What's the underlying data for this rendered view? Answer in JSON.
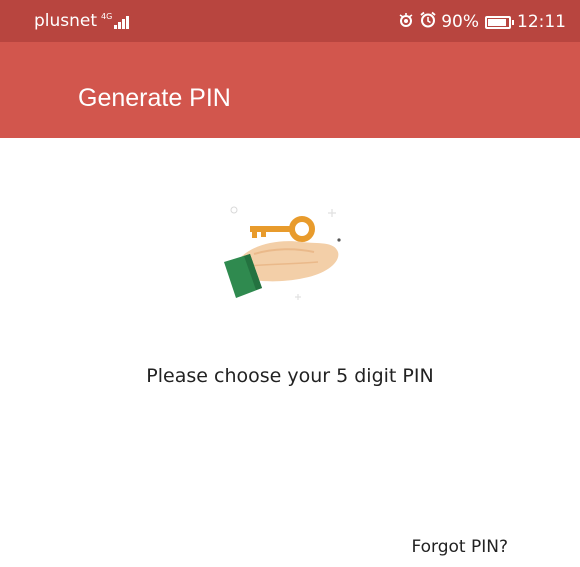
{
  "status_bar": {
    "carrier": "plusnet",
    "network_type": "4G",
    "battery": "90%",
    "time": "12:11"
  },
  "app_bar": {
    "title": "Generate PIN"
  },
  "main": {
    "prompt": "Please choose your 5 digit PIN",
    "forgot_link": "Forgot PIN?"
  },
  "colors": {
    "status_bar": "#b8453f",
    "app_bar": "#d2564d",
    "key": "#e89b2c",
    "cuff": "#2f8a4f"
  }
}
